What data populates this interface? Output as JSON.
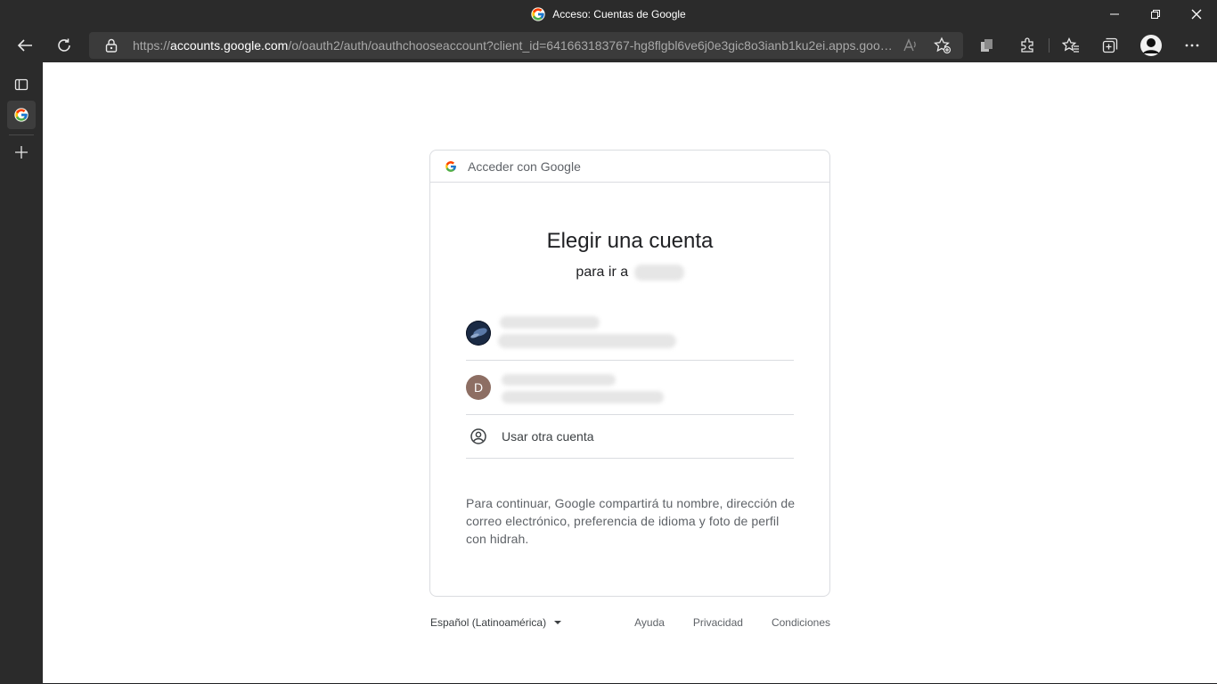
{
  "window": {
    "title": "Acceso: Cuentas de Google"
  },
  "browser": {
    "url_scheme": "https://",
    "url_host": "accounts.google.com",
    "url_path": "/o/oauth2/auth/oauthchooseaccount?client_id=641663183767-hg8flgbl6ve6j0e3gic8o3ianb1ku2ei.apps.goo…"
  },
  "card": {
    "header": "Acceder con Google",
    "title": "Elegir una cuenta",
    "subtitle_prefix": "para ir a",
    "accounts": [
      {
        "avatar_letter": "",
        "avatar_color": "#1a2a44"
      },
      {
        "avatar_letter": "D",
        "avatar_color": "#8d6e63"
      }
    ],
    "use_other": "Usar otra cuenta",
    "notice": "Para continuar, Google compartirá tu nombre, dirección de correo electrónico, preferencia de idioma y foto de perfil con hidrah."
  },
  "footer": {
    "language": "Español (Latinoamérica)",
    "help": "Ayuda",
    "privacy": "Privacidad",
    "terms": "Condiciones"
  },
  "colors": {
    "chrome_bg": "#2b2b2b",
    "page_bg": "#ffffff",
    "border": "#dadce0"
  }
}
